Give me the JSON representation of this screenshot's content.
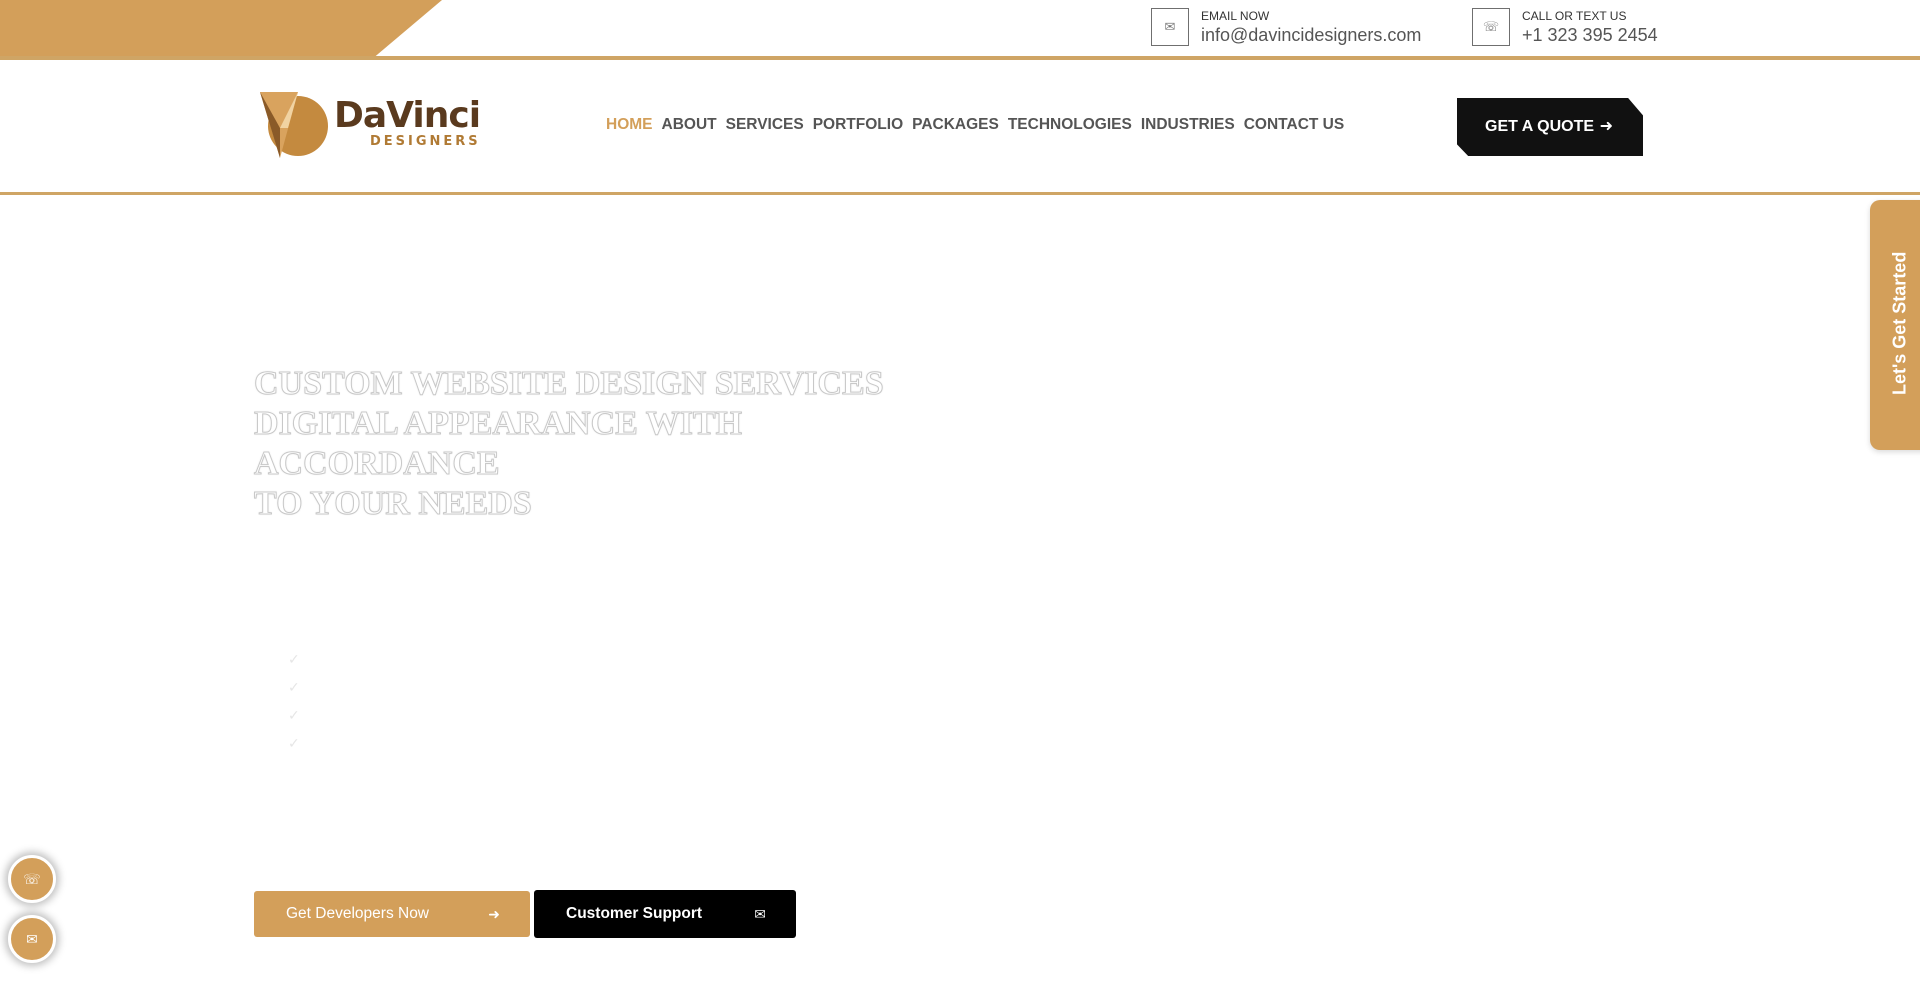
{
  "topbar": {
    "email": {
      "label": "EMAIL NOW",
      "value": "info@davincidesigners.com",
      "icon": "envelope-icon"
    },
    "phone": {
      "label": "CALL OR TEXT US",
      "value": "+1 323 395 2454",
      "icon": "phone-icon"
    }
  },
  "logo": {
    "name": "DaVinci",
    "sub": "DESIGNERS"
  },
  "nav": {
    "items": [
      "HOME",
      "ABOUT",
      "SERVICES",
      "PORTFOLIO",
      "PACKAGES",
      "TECHNOLOGIES",
      "INDUSTRIES",
      "CONTACT US"
    ],
    "active": "HOME"
  },
  "quote_button": {
    "label": "GET A QUOTE",
    "icon": "arrow-right-icon"
  },
  "hero": {
    "title_lines": [
      "CUSTOM WEBSITE DESIGN SERVICES",
      "DIGITAL APPEARANCE WITH",
      "ACCORDANCE",
      "TO YOUR NEEDS"
    ],
    "checks": [
      "✓",
      "✓",
      "✓",
      "✓"
    ]
  },
  "side_tab": {
    "label": "Let's Get Started"
  },
  "cta": {
    "primary": {
      "label": "Get Developers Now",
      "icon": "arrow-right-icon"
    },
    "secondary": {
      "label": "Customer Support",
      "icon": "chat-icon"
    }
  },
  "floating": [
    {
      "icon": "phone-icon"
    },
    {
      "icon": "chat-icon"
    }
  ],
  "colors": {
    "accent": "#d39f5a",
    "dark": "#111111",
    "nav_text": "#555555"
  }
}
